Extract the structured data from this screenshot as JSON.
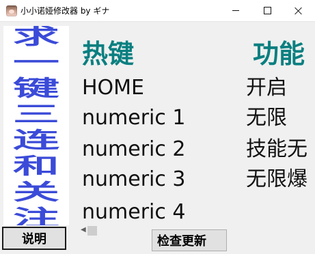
{
  "window": {
    "title": "小小诺娅修改器 by ギナ",
    "controls": [
      "minimize-icon",
      "maximize-icon",
      "close-icon"
    ]
  },
  "banner": {
    "chars": [
      "求",
      "一",
      "键",
      "三",
      "连",
      "和",
      "关",
      "注"
    ],
    "color": "#3b4bd8"
  },
  "table": {
    "header_key": "热键",
    "header_func": "功能",
    "header_color": "#0a7f80",
    "rows": [
      {
        "key": "HOME",
        "func": "开启"
      },
      {
        "key": "numeric 1",
        "func": "无限"
      },
      {
        "key": "numeric 2",
        "func": "技能无"
      },
      {
        "key": "numeric 3",
        "func": "无限爆"
      },
      {
        "key": "numeric 4",
        "func": ""
      }
    ]
  },
  "buttons": {
    "explain": "说明",
    "update": "检查更新"
  }
}
